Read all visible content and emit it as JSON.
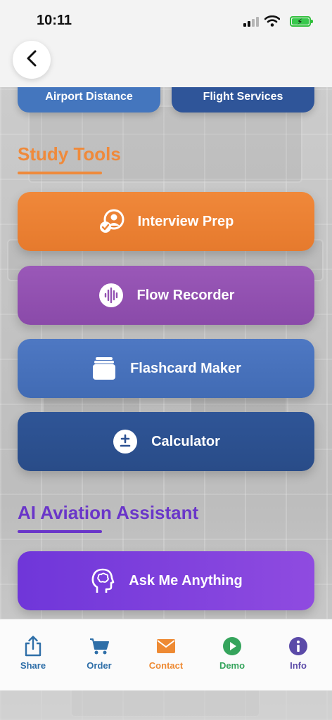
{
  "status_bar": {
    "time": "10:11"
  },
  "header": {
    "back_icon": "chevron-left-icon"
  },
  "top_buttons": {
    "airport_distance": "Airport Distance",
    "flight_services": "Flight Services"
  },
  "study_tools": {
    "title": "Study Tools",
    "title_color": "#ef8a3b",
    "items": [
      {
        "label": "Interview Prep",
        "icon": "interview-icon",
        "color": "#ee873a"
      },
      {
        "label": "Flow Recorder",
        "icon": "waveform-icon",
        "color": "#9353b2"
      },
      {
        "label": "Flashcard Maker",
        "icon": "flashcards-icon",
        "color": "#4a73bf"
      },
      {
        "label": "Calculator",
        "icon": "plus-minus-icon",
        "color": "#2c5192"
      }
    ]
  },
  "ai_assistant": {
    "title": "AI Aviation Assistant",
    "title_color": "#6a36c9",
    "items": [
      {
        "label": "Ask Me Anything",
        "icon": "brain-icon",
        "color": "#7d40dd"
      }
    ]
  },
  "tab_bar": {
    "items": [
      {
        "label": "Share",
        "icon": "share-icon"
      },
      {
        "label": "Order",
        "icon": "cart-icon"
      },
      {
        "label": "Contact",
        "icon": "envelope-icon"
      },
      {
        "label": "Demo",
        "icon": "play-icon"
      },
      {
        "label": "Info",
        "icon": "info-icon"
      }
    ]
  }
}
